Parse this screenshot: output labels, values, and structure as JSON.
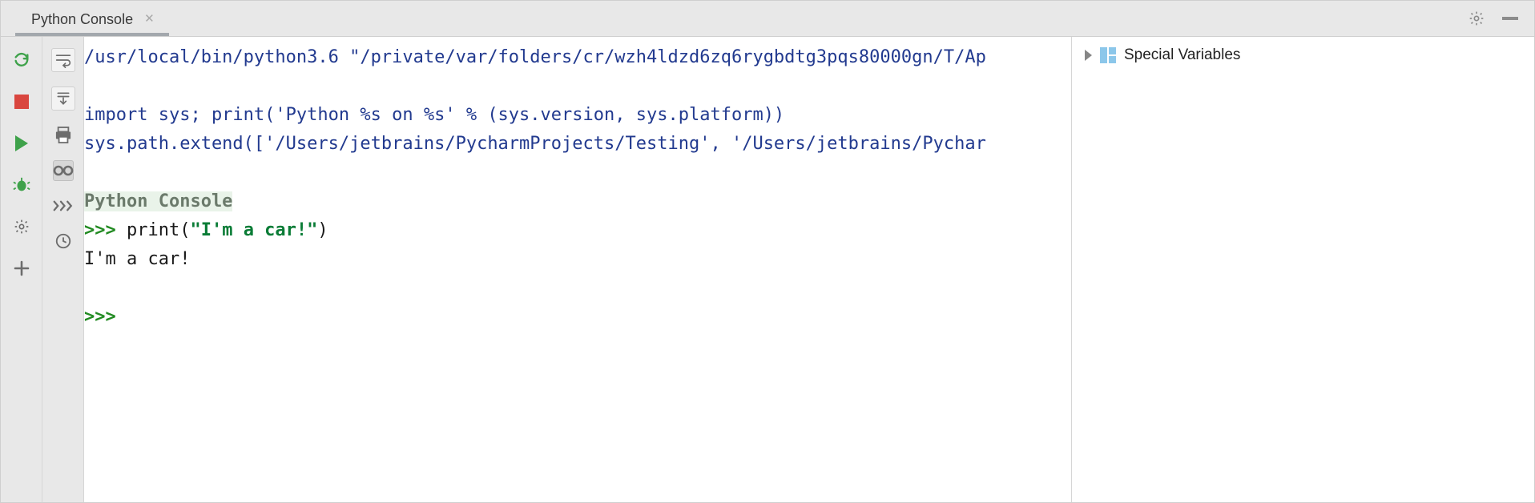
{
  "tab": {
    "title": "Python Console"
  },
  "console": {
    "interpreter_line": "/usr/local/bin/python3.6 \"/private/var/folders/cr/wzh4ldzd6zq6rygbdtg3pqs80000gn/T/Ap",
    "import_line": "import sys; print('Python %s on %s' % (sys.version, sys.platform))",
    "extend_line": "sys.path.extend(['/Users/jetbrains/PycharmProjects/Testing', '/Users/jetbrains/Pychar",
    "heading": "Python Console",
    "prompt1": ">>> ",
    "stmt_prefix": "print(",
    "stmt_string": "\"I'm a car!\"",
    "stmt_suffix": ")",
    "output": "I'm a car!",
    "prompt2": ">>> "
  },
  "vars": {
    "special": "Special Variables"
  },
  "icons": {
    "rerun": "rerun",
    "stop": "stop",
    "run": "run",
    "debug": "debug",
    "settings": "settings",
    "add": "add",
    "softwrap": "soft-wrap",
    "scroll_end": "scroll-to-end",
    "print": "print",
    "vars_view": "show-variables",
    "exec_multi": "execute-multiline",
    "history": "history",
    "hdr_settings": "settings",
    "hdr_hide": "hide"
  }
}
